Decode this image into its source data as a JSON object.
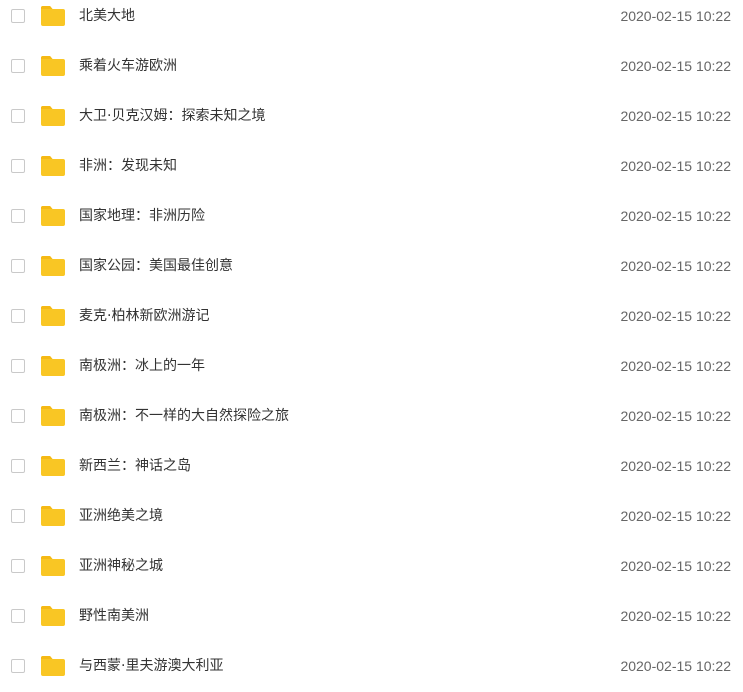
{
  "colors": {
    "folder": "#f9c624",
    "folder_tab": "#f5b914",
    "checkbox_border": "#c9c9c9",
    "name_text": "#333333",
    "date_text": "#666666"
  },
  "icons": {
    "folder": "folder-icon",
    "checkbox": "checkbox-unchecked"
  },
  "files": [
    {
      "name": "北美大地",
      "modified": "2020-02-15 10:22"
    },
    {
      "name": "乘着火车游欧洲",
      "modified": "2020-02-15 10:22"
    },
    {
      "name": "大卫·贝克汉姆：探索未知之境",
      "modified": "2020-02-15 10:22"
    },
    {
      "name": "非洲：发现未知",
      "modified": "2020-02-15 10:22"
    },
    {
      "name": "国家地理：非洲历险",
      "modified": "2020-02-15 10:22"
    },
    {
      "name": "国家公园：美国最佳创意",
      "modified": "2020-02-15 10:22"
    },
    {
      "name": "麦克·柏林新欧洲游记",
      "modified": "2020-02-15 10:22"
    },
    {
      "name": "南极洲：冰上的一年",
      "modified": "2020-02-15 10:22"
    },
    {
      "name": "南极洲：不一样的大自然探险之旅",
      "modified": "2020-02-15 10:22"
    },
    {
      "name": "新西兰：神话之岛",
      "modified": "2020-02-15 10:22"
    },
    {
      "name": "亚洲绝美之境",
      "modified": "2020-02-15 10:22"
    },
    {
      "name": "亚洲神秘之城",
      "modified": "2020-02-15 10:22"
    },
    {
      "name": "野性南美洲",
      "modified": "2020-02-15 10:22"
    },
    {
      "name": "与西蒙·里夫游澳大利亚",
      "modified": "2020-02-15 10:22"
    }
  ]
}
